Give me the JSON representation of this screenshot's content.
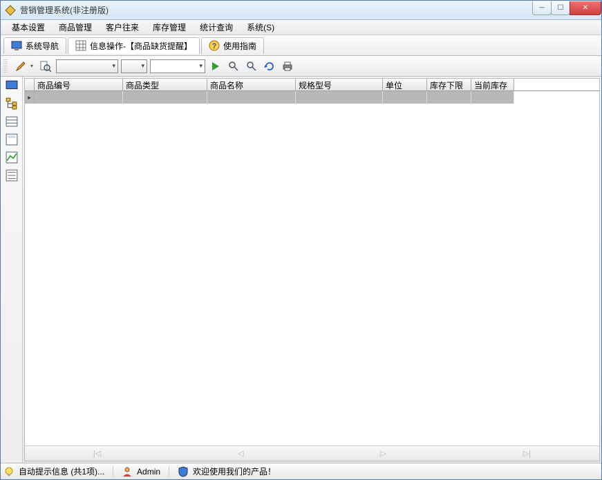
{
  "window": {
    "title": "营销管理系统(非注册版)"
  },
  "menu": [
    "基本设置",
    "商品管理",
    "客户往来",
    "库存管理",
    "统计查询",
    "系统(S)"
  ],
  "tabs": [
    {
      "label": "系统导航",
      "active": false
    },
    {
      "label": "信息操作-【商品缺货提醒】",
      "active": true
    },
    {
      "label": "使用指南",
      "active": false
    }
  ],
  "toolbar": {
    "combo1": "",
    "combo2": "",
    "combo3": ""
  },
  "columns": [
    "商品编号",
    "商品类型",
    "商品名称",
    "规格型号",
    "单位",
    "库存下限",
    "当前库存"
  ],
  "status": {
    "hint": "自动提示信息 (共1项)...",
    "user": "Admin",
    "welcome": "欢迎使用我们的产品！"
  },
  "nav": {
    "first": "|◁",
    "prev": "◁",
    "next": "▷",
    "last": "▷|"
  }
}
